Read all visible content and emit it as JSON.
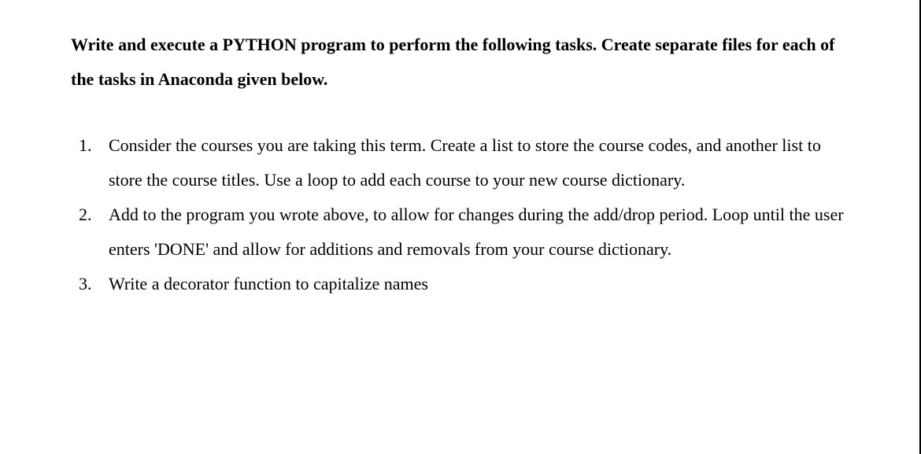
{
  "instruction": "Write and execute a PYTHON program to perform the following tasks.  Create separate files for each of the tasks in Anaconda given below.",
  "tasks": [
    {
      "text": "Consider the courses you are taking this term.   Create a list to store the course codes, and another list to store the course titles.  Use a loop to add each course to your new course dictionary."
    },
    {
      "text": "Add to the program you wrote above, to allow for changes during the add/drop period.  Loop until the user enters 'DONE' and allow for additions and removals from your course dictionary."
    },
    {
      "text": "Write a decorator function to capitalize names"
    }
  ]
}
